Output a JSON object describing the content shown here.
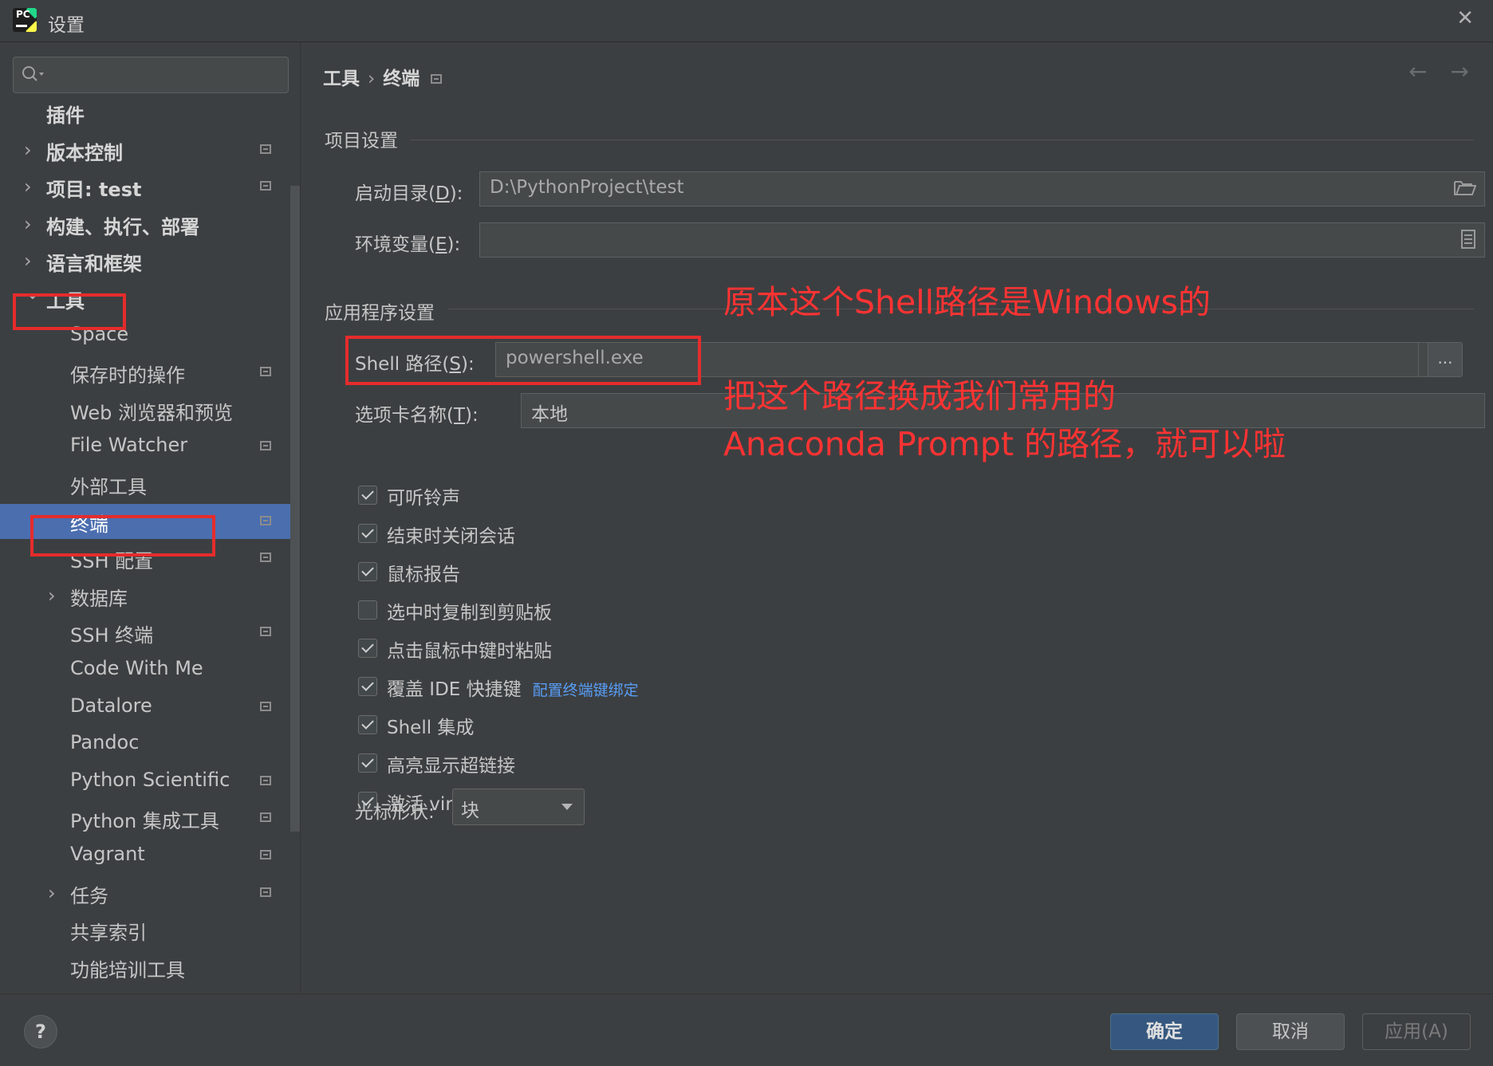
{
  "window": {
    "title": "设置",
    "close_glyph": "✕",
    "logo_text": "PC"
  },
  "sidebar": {
    "items": [
      {
        "label": "插件",
        "bold": true,
        "indent": 0,
        "chevron": "",
        "proj": false,
        "selected": false
      },
      {
        "label": "版本控制",
        "bold": true,
        "indent": 0,
        "chevron": "›",
        "proj": true,
        "selected": false
      },
      {
        "label": "项目: test",
        "bold": true,
        "indent": 0,
        "chevron": "›",
        "proj": true,
        "selected": false
      },
      {
        "label": "构建、执行、部署",
        "bold": true,
        "indent": 0,
        "chevron": "›",
        "proj": false,
        "selected": false
      },
      {
        "label": "语言和框架",
        "bold": true,
        "indent": 0,
        "chevron": "›",
        "proj": false,
        "selected": false
      },
      {
        "label": "工具",
        "bold": true,
        "indent": 0,
        "chevron": "⌄",
        "proj": false,
        "selected": false
      },
      {
        "label": "Space",
        "bold": false,
        "indent": 1,
        "chevron": "",
        "proj": false,
        "selected": false
      },
      {
        "label": "保存时的操作",
        "bold": false,
        "indent": 1,
        "chevron": "",
        "proj": true,
        "selected": false
      },
      {
        "label": "Web 浏览器和预览",
        "bold": false,
        "indent": 1,
        "chevron": "",
        "proj": false,
        "selected": false
      },
      {
        "label": "File Watcher",
        "bold": false,
        "indent": 1,
        "chevron": "",
        "proj": true,
        "selected": false
      },
      {
        "label": "外部工具",
        "bold": false,
        "indent": 1,
        "chevron": "",
        "proj": false,
        "selected": false
      },
      {
        "label": "终端",
        "bold": false,
        "indent": 1,
        "chevron": "",
        "proj": true,
        "selected": true
      },
      {
        "label": "SSH 配置",
        "bold": false,
        "indent": 1,
        "chevron": "",
        "proj": true,
        "selected": false
      },
      {
        "label": "数据库",
        "bold": false,
        "indent": 1,
        "chevron": "›",
        "proj": false,
        "selected": false
      },
      {
        "label": "SSH 终端",
        "bold": false,
        "indent": 1,
        "chevron": "",
        "proj": true,
        "selected": false
      },
      {
        "label": "Code With Me",
        "bold": false,
        "indent": 1,
        "chevron": "",
        "proj": false,
        "selected": false
      },
      {
        "label": "Datalore",
        "bold": false,
        "indent": 1,
        "chevron": "",
        "proj": true,
        "selected": false
      },
      {
        "label": "Pandoc",
        "bold": false,
        "indent": 1,
        "chevron": "",
        "proj": false,
        "selected": false
      },
      {
        "label": "Python Scientific",
        "bold": false,
        "indent": 1,
        "chevron": "",
        "proj": true,
        "selected": false
      },
      {
        "label": "Python 集成工具",
        "bold": false,
        "indent": 1,
        "chevron": "",
        "proj": true,
        "selected": false
      },
      {
        "label": "Vagrant",
        "bold": false,
        "indent": 1,
        "chevron": "",
        "proj": true,
        "selected": false
      },
      {
        "label": "任务",
        "bold": false,
        "indent": 1,
        "chevron": "›",
        "proj": true,
        "selected": false
      },
      {
        "label": "共享索引",
        "bold": false,
        "indent": 1,
        "chevron": "",
        "proj": false,
        "selected": false
      },
      {
        "label": "功能培训工具",
        "bold": false,
        "indent": 1,
        "chevron": "",
        "proj": false,
        "selected": false
      }
    ]
  },
  "breadcrumb": {
    "parent": "工具",
    "sep": "›",
    "current": "终端"
  },
  "nav": {
    "back": "←",
    "forward": "→"
  },
  "project_settings": {
    "title": "项目设置",
    "start_dir_label_pre": "启动目录(",
    "start_dir_label_key": "D",
    "start_dir_label_post": "):",
    "start_dir_value": "D:\\PythonProject\\test",
    "env_label_pre": "环境变量(",
    "env_label_key": "E",
    "env_label_post": "):",
    "env_value": ""
  },
  "app_settings": {
    "title": "应用程序设置",
    "shell_label_pre": "Shell 路径(",
    "shell_label_key": "S",
    "shell_label_post": "):",
    "shell_value": "powershell.exe",
    "ellipsis": "...",
    "tab_label_pre": "选项卡名称(",
    "tab_label_key": "T",
    "tab_label_post": "):",
    "tab_value": "本地",
    "checkboxes": [
      {
        "label": "可听铃声",
        "checked": true,
        "link": ""
      },
      {
        "label": "结束时关闭会话",
        "checked": true,
        "link": ""
      },
      {
        "label": "鼠标报告",
        "checked": true,
        "link": ""
      },
      {
        "label": "选中时复制到剪贴板",
        "checked": false,
        "link": ""
      },
      {
        "label": "点击鼠标中键时粘贴",
        "checked": true,
        "link": ""
      },
      {
        "label": "覆盖 IDE 快捷键",
        "checked": true,
        "link": "配置终端键绑定"
      },
      {
        "label": "Shell 集成",
        "checked": true,
        "link": ""
      },
      {
        "label": "高亮显示超链接",
        "checked": true,
        "link": ""
      },
      {
        "label": "激活 virtualenv",
        "checked": true,
        "link": ""
      }
    ],
    "cursor_label": "光标形状:",
    "cursor_value": "块"
  },
  "annotations": {
    "line1": "原本这个Shell路径是Windows的",
    "line2": "把这个路径换成我们常用的",
    "line3": "Anaconda Prompt 的路径，就可以啦"
  },
  "footer": {
    "help": "?",
    "ok": "确定",
    "cancel": "取消",
    "apply": "应用(A)"
  }
}
